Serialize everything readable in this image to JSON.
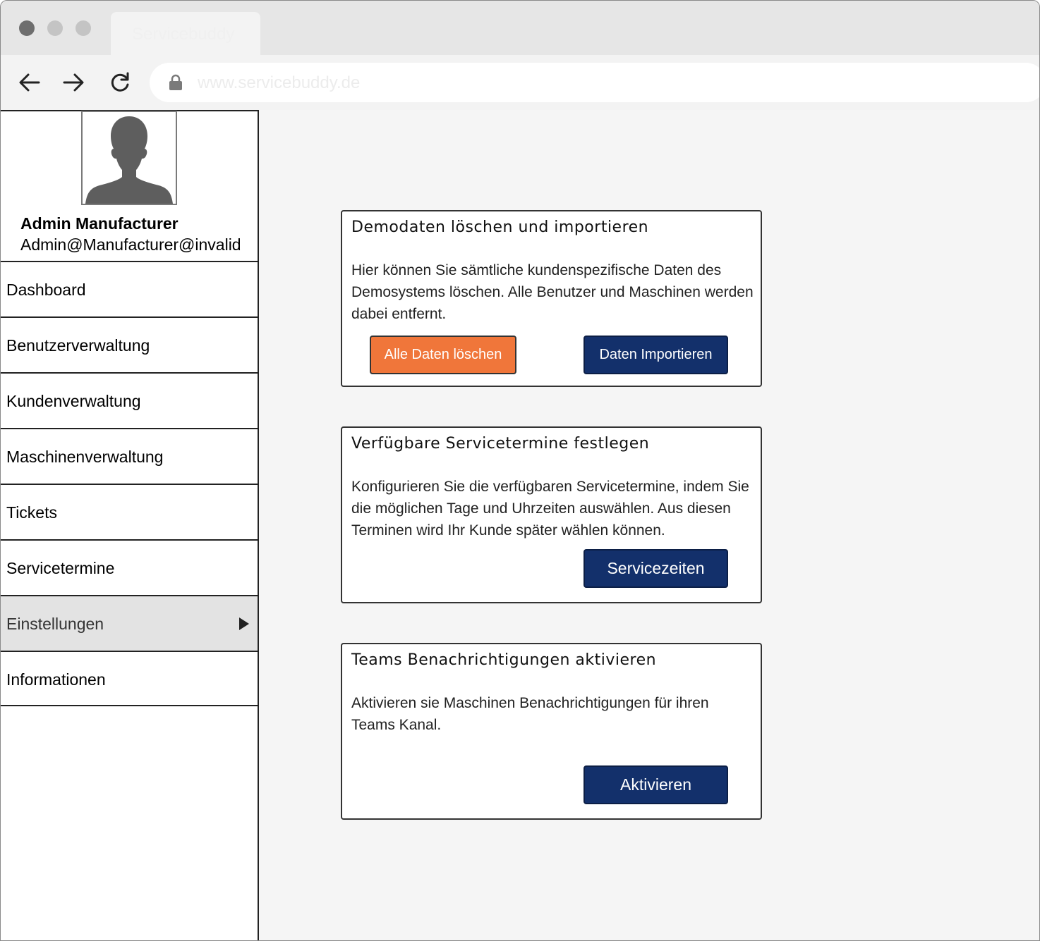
{
  "browser": {
    "tab_title": "Servicebuddy",
    "url": "www.servicebuddy.de"
  },
  "profile": {
    "name": "Admin Manufacturer",
    "email": "Admin@Manufacturer@invalid"
  },
  "menu": {
    "items": [
      {
        "label": "Dashboard"
      },
      {
        "label": "Benutzerverwaltung"
      },
      {
        "label": "Kundenverwaltung"
      },
      {
        "label": "Maschinenverwaltung"
      },
      {
        "label": "Tickets"
      },
      {
        "label": "Servicetermine"
      },
      {
        "label": "Einstellungen",
        "active": true
      },
      {
        "label": "Informationen"
      }
    ]
  },
  "cards": {
    "demo": {
      "title": "Demodaten löschen und importieren",
      "text": "Hier können Sie sämtliche kundenspezifische Daten des Demosystems löschen. Alle Benutzer und Maschinen werden dabei entfernt.",
      "delete_label": "Alle Daten löschen",
      "import_label": "Daten Importieren"
    },
    "service": {
      "title": "Verfügbare Servicetermine festlegen",
      "text": "Konfigurieren Sie die verfügbaren Servicetermine, indem Sie die möglichen Tage und Uhrzeiten auswählen. Aus diesen Terminen wird Ihr Kunde später wählen können.",
      "button_label": "Servicezeiten"
    },
    "teams": {
      "title": "Teams Benachrichtigungen aktivieren",
      "text": "Aktivieren sie Maschinen Benachrichtigungen für ihren  Teams Kanal.",
      "button_label": "Aktivieren"
    }
  },
  "colors": {
    "accent_orange": "#f0763a",
    "accent_navy": "#13306b",
    "active_menu_bg": "#e3e3e3"
  }
}
